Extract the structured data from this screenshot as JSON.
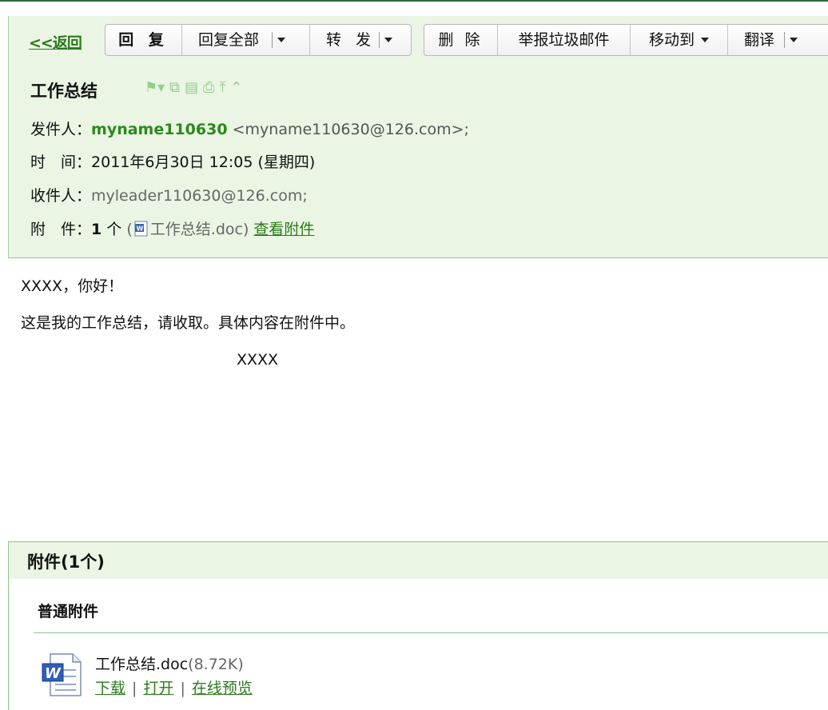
{
  "toolbar": {
    "back": "<<返回",
    "reply": "回 复",
    "reply_all": "回复全部",
    "forward": "转 发",
    "delete": "删 除",
    "report_spam": "举报垃圾邮件",
    "move_to": "移动到",
    "translate": "翻译"
  },
  "mail": {
    "subject": "工作总结",
    "sender_label": "发件人：",
    "sender_name": "myname110630",
    "sender_addr": "<myname110630@126.com>;",
    "time_label": "时　间：",
    "time_value": "2011年6月30日 12:05 (星期四)",
    "to_label": "收件人：",
    "to_value": "myleader110630@126.com;",
    "att_label": "附　件：",
    "att_count": "1",
    "att_unit": "个",
    "att_open_paren": "(",
    "att_filename": "工作总结.doc",
    "att_close_paren": ")",
    "view_att_link": "查看附件"
  },
  "body": {
    "line1": "XXXX，你好！",
    "line2": "这是我的工作总结，请收取。具体内容在附件中。",
    "line3": "XXXX"
  },
  "attachments": {
    "header": "附件(1个)",
    "section": "普通附件",
    "file_name": "工作总结.doc",
    "file_size": "(8.72K)",
    "download": "下载",
    "open": "打开",
    "preview": "在线预览",
    "separator": "|"
  },
  "colors": {
    "panel_bg": "#eaf5e3",
    "accent_green": "#2a7a1a",
    "border_green": "#8fc58f"
  }
}
